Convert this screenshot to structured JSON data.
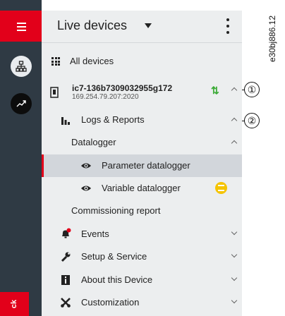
{
  "rail": {
    "menu_icon": "hamburger-icon",
    "devices_icon": "network-icon",
    "trend_icon": "trend-icon",
    "bottom_tab_label": "ck"
  },
  "header": {
    "title": "Live devices"
  },
  "all_devices": {
    "label": "All devices"
  },
  "device": {
    "name": "ic7-136b7309032955g172",
    "ip": "169.254.79.207:2020",
    "status_icon": "sort-arrows-icon",
    "status_color": "#3aaa35"
  },
  "nav": {
    "logs_reports": "Logs & Reports",
    "datalogger": "Datalogger",
    "parameter_datalogger": "Parameter datalogger",
    "variable_datalogger": "Variable datalogger",
    "commissioning_report": "Commissioning report",
    "events": "Events",
    "setup_service": "Setup & Service",
    "about_device": "About this Device",
    "customization": "Customization"
  },
  "callouts": {
    "one": "①",
    "two": "②"
  },
  "doc_id": "e30bj886.12",
  "colors": {
    "brand_red": "#e2001a",
    "rail_dark": "#2f3a44",
    "panel_bg": "#eceeef",
    "selected_bg": "#d2d6db",
    "warning_yellow": "#f5c400"
  }
}
